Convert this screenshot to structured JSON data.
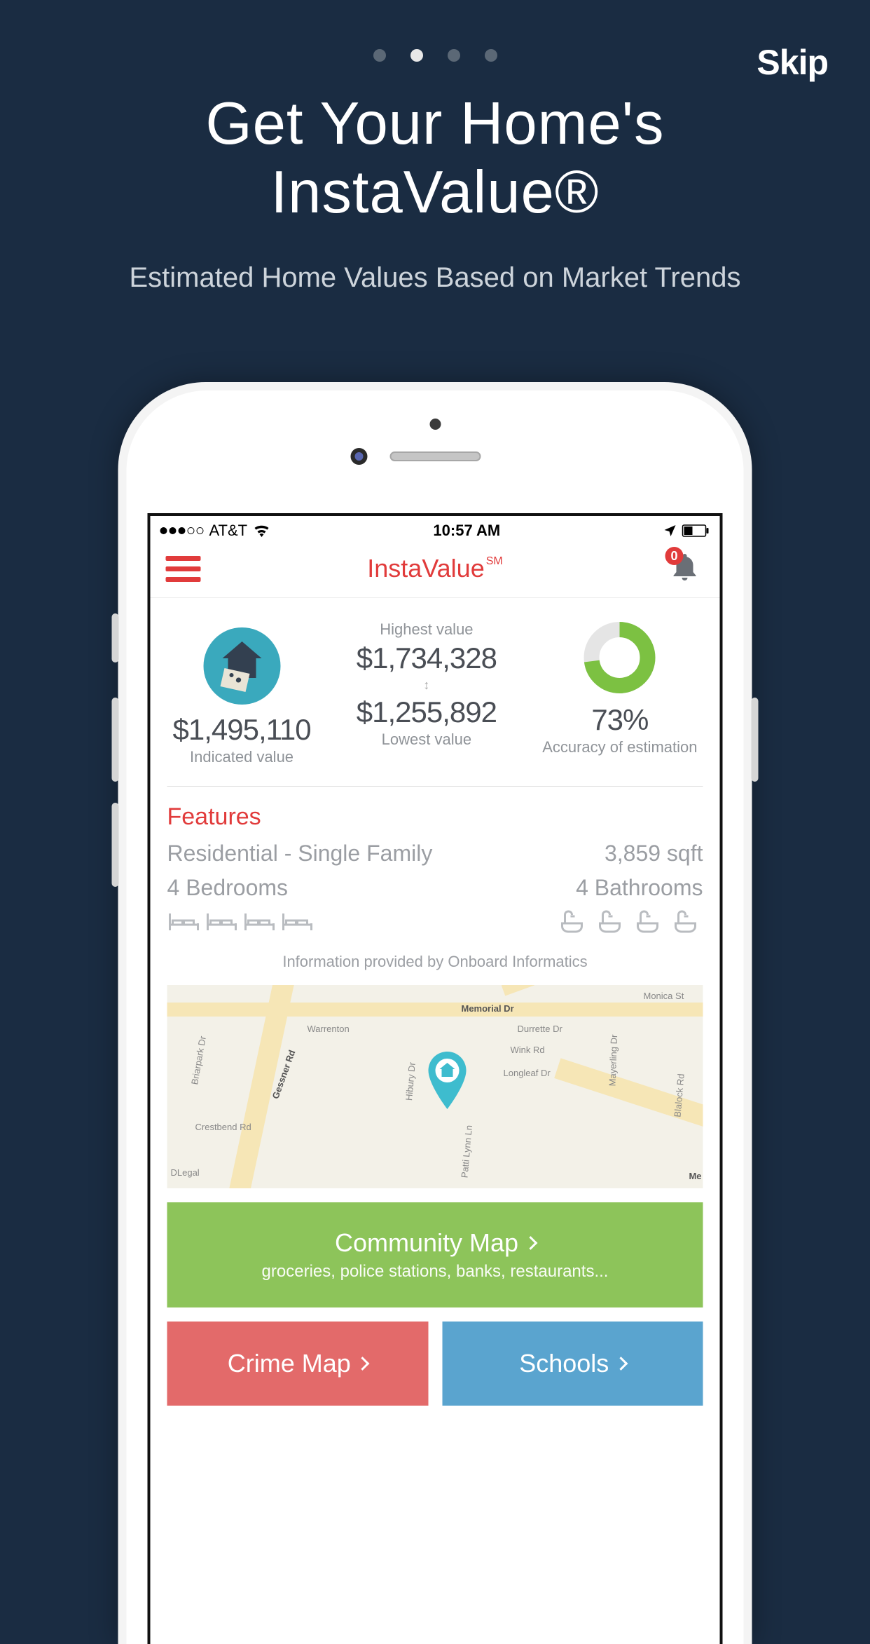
{
  "onboarding": {
    "skip_label": "Skip",
    "title_line1": "Get Your Home's",
    "title_line2": "InstaValue®",
    "subtitle": "Estimated Home Values Based on Market Trends",
    "active_dot_index": 1,
    "dot_count": 4
  },
  "status_bar": {
    "carrier": "AT&T",
    "time": "10:57 AM"
  },
  "app_nav": {
    "title": "InstaValue",
    "title_suffix": "SM",
    "badge_count": "0"
  },
  "values": {
    "indicated": {
      "amount": "$1,495,110",
      "label": "Indicated value"
    },
    "highest": {
      "label": "Highest value",
      "amount": "$1,734,328"
    },
    "lowest": {
      "amount": "$1,255,892",
      "label": "Lowest value"
    },
    "accuracy": {
      "percent": "73%",
      "label": "Accuracy of estimation",
      "value": 73
    }
  },
  "features": {
    "section_title": "Features",
    "type": "Residential - Single Family",
    "sqft": "3,859 sqft",
    "bedrooms_label": "4 Bedrooms",
    "bathrooms_label": "4 Bathrooms",
    "bedroom_count": 4,
    "bathroom_count": 4,
    "provider": "Information provided by Onboard Informatics"
  },
  "map": {
    "roads": [
      "Gessner Rd",
      "Memorial Dr",
      "Durrette Dr",
      "Wink Rd",
      "Longleaf Dr",
      "Mayerling Dr",
      "Briarpark Dr",
      "Crestbend Rd",
      "Warrenton",
      "Hibury Dr",
      "Patti Lynn Ln",
      "Blalock Rd",
      "Monica St",
      "DLegal",
      "Me"
    ]
  },
  "tiles": {
    "community": {
      "title": "Community Map",
      "subtitle": "groceries, police stations, banks, restaurants..."
    },
    "crime": {
      "title": "Crime Map"
    },
    "schools": {
      "title": "Schools"
    }
  }
}
